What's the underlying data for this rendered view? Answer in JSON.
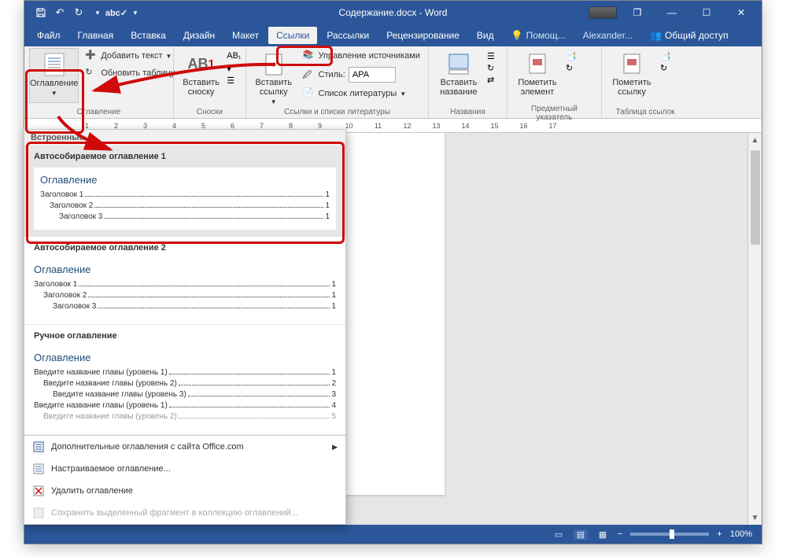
{
  "title": "Содержание.docx - Word",
  "qat": {
    "save": "Сохранить",
    "undo": "Отменить",
    "redo": "Повторить",
    "spelling": "Правописание",
    "customize": "Настроить"
  },
  "menubar": [
    {
      "label": "Файл",
      "active": false
    },
    {
      "label": "Главная",
      "active": false
    },
    {
      "label": "Вставка",
      "active": false
    },
    {
      "label": "Дизайн",
      "active": false
    },
    {
      "label": "Макет",
      "active": false
    },
    {
      "label": "Ссылки",
      "active": true
    },
    {
      "label": "Рассылки",
      "active": false
    },
    {
      "label": "Рецензирование",
      "active": false
    },
    {
      "label": "Вид",
      "active": false
    }
  ],
  "tell_me": "Помощ...",
  "user": "Alexander...",
  "share": "Общий доступ",
  "ribbon": {
    "groups": {
      "toc": {
        "label": "Оглавление",
        "btn_toc": "Оглавление",
        "add_text": "Добавить текст",
        "update": "Обновить таблицу"
      },
      "footnotes": {
        "label": "Сноски",
        "insert": "Вставить сноску",
        "ab": "AB"
      },
      "citations": {
        "label": "Ссылки и списки литературы",
        "insert": "Вставить ссылку",
        "manage": "Управление источниками",
        "style": "Стиль:",
        "style_value": "APA",
        "bibliography": "Список литературы"
      },
      "captions": {
        "label": "Названия",
        "insert": "Вставить название"
      },
      "index": {
        "label": "Предметный указатель",
        "insert": "Пометить элемент"
      },
      "toa": {
        "label": "Таблица ссылок",
        "insert": "Пометить ссылку"
      }
    }
  },
  "ruler_ticks": [
    "1",
    "",
    "1",
    "2",
    "3",
    "4",
    "5",
    "6",
    "7",
    "8",
    "9",
    "10",
    "11",
    "12",
    "13",
    "14",
    "15",
    "16",
    "17"
  ],
  "gallery": {
    "section_header": "Встроенные",
    "options": [
      {
        "title": "Автособираемое оглавление 1",
        "preview_title": "Оглавление",
        "lines": [
          {
            "text": "Заголовок 1",
            "page": "1",
            "indent": 0
          },
          {
            "text": "Заголовок 2",
            "page": "1",
            "indent": 1
          },
          {
            "text": "Заголовок 3",
            "page": "1",
            "indent": 2
          }
        ],
        "highlighted": true
      },
      {
        "title": "Автособираемое оглавление 2",
        "preview_title": "Оглавление",
        "lines": [
          {
            "text": "Заголовок 1",
            "page": "1",
            "indent": 0
          },
          {
            "text": "Заголовок 2",
            "page": "1",
            "indent": 1
          },
          {
            "text": "Заголовок 3",
            "page": "1",
            "indent": 2
          }
        ]
      },
      {
        "title": "Ручное оглавление",
        "preview_title": "Оглавление",
        "lines": [
          {
            "text": "Введите название главы (уровень 1)",
            "page": "1",
            "indent": 0
          },
          {
            "text": "Введите название главы (уровень 2)",
            "page": "2",
            "indent": 1
          },
          {
            "text": "Введите название главы (уровень 3)",
            "page": "3",
            "indent": 2
          },
          {
            "text": "Введите название главы (уровень 1)",
            "page": "4",
            "indent": 0
          },
          {
            "text": "Введите название главы (уровень 2)",
            "page": "5",
            "indent": 1
          }
        ]
      }
    ],
    "footer": {
      "more_office": "Дополнительные оглавления с сайта Office.com",
      "custom": "Настраиваемое оглавление...",
      "remove": "Удалить оглавление",
      "save_selection": "Сохранить выделенный фрагмент в коллекцию оглавлений..."
    }
  },
  "statusbar": {
    "zoom": "100%"
  },
  "colors": {
    "accent": "#2b579a",
    "highlight": "#cf0a0a"
  }
}
